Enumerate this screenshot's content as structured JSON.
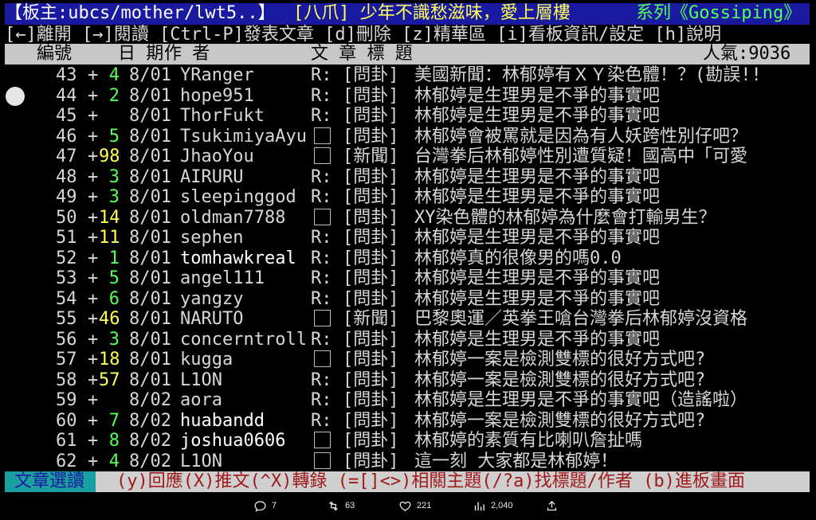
{
  "titlebar": {
    "board": "【板主:ubcs/mother/lwt5..】",
    "category": "[八爪] 少年不識愁滋味，愛上層樓",
    "series": "系列《Gossiping》"
  },
  "keys_line": "[←]離開 [→]閱讀 [Ctrl-P]發表文章 [d]刪除 [z]精華區 [i]看板資訊/設定 [h]說明",
  "header": {
    "num": "編號",
    "date": "日 期",
    "author": "作  者",
    "title": "文  章  標  題",
    "popularity": "人氣:9036"
  },
  "rows": [
    {
      "num": "43",
      "score": "4",
      "date": "8/01",
      "author": "YRanger",
      "mark": "R:",
      "tag": "[問卦]",
      "title": "美國新聞：林郁婷有ＸＹ染色體！？(勘誤!!"
    },
    {
      "num": "44",
      "score": "2",
      "date": "8/01",
      "author": "hope951",
      "mark": "R:",
      "tag": "[問卦]",
      "title": "林郁婷是生理男是不爭的事實吧"
    },
    {
      "num": "45",
      "score": "",
      "date": "8/01",
      "author": "ThorFukt",
      "mark": "R:",
      "tag": "[問卦]",
      "title": "林郁婷是生理男是不爭的事實吧"
    },
    {
      "num": "46",
      "score": "5",
      "date": "8/01",
      "author": "TsukimiyaAyu",
      "mark": "box",
      "tag": "[問卦]",
      "title": "林郁婷會被罵就是因為有人妖跨性別仔吧？"
    },
    {
      "num": "47",
      "score": "98",
      "date": "8/01",
      "author": "JhaoYou",
      "mark": "box",
      "tag": "[新聞]",
      "title": "台灣拳后林郁婷性別遭質疑！國高中「可愛"
    },
    {
      "num": "48",
      "score": "3",
      "date": "8/01",
      "author": "AIRURU",
      "mark": "R:",
      "tag": "[問卦]",
      "title": "林郁婷是生理男是不爭的事實吧"
    },
    {
      "num": "49",
      "score": "3",
      "date": "8/01",
      "author": "sleepinggod",
      "mark": "R:",
      "tag": "[問卦]",
      "title": "林郁婷是生理男是不爭的事實吧"
    },
    {
      "num": "50",
      "score": "14",
      "date": "8/01",
      "author": "oldman7788",
      "mark": "box",
      "tag": "[問卦]",
      "title": "XY染色體的林郁婷為什麼會打輸男生？"
    },
    {
      "num": "51",
      "score": "11",
      "date": "8/01",
      "author": "sephen",
      "mark": "R:",
      "tag": "[問卦]",
      "title": "林郁婷是生理男是不爭的事實吧"
    },
    {
      "num": "52",
      "score": "1",
      "date": "8/01",
      "author": "tomhawkreal",
      "mark": "R:",
      "tag": "[問卦]",
      "title": "林郁婷真的很像男的嗎0.0"
    },
    {
      "num": "53",
      "score": "5",
      "date": "8/01",
      "author": "angel111",
      "mark": "R:",
      "tag": "[問卦]",
      "title": "林郁婷是生理男是不爭的事實吧"
    },
    {
      "num": "54",
      "score": "6",
      "date": "8/01",
      "author": "yangzy",
      "mark": "R:",
      "tag": "[問卦]",
      "title": "林郁婷是生理男是不爭的事實吧"
    },
    {
      "num": "55",
      "score": "46",
      "date": "8/01",
      "author": "NARUTO",
      "mark": "box",
      "tag": "[新聞]",
      "title": "巴黎奧運／英拳王嗆台灣拳后林郁婷沒資格"
    },
    {
      "num": "56",
      "score": "3",
      "date": "8/01",
      "author": "concerntroll",
      "mark": "R:",
      "tag": "[問卦]",
      "title": "林郁婷是生理男是不爭的事實吧"
    },
    {
      "num": "57",
      "score": "18",
      "date": "8/01",
      "author": "kugga",
      "mark": "box",
      "tag": "[問卦]",
      "title": "林郁婷一案是檢測雙標的很好方式吧?"
    },
    {
      "num": "58",
      "score": "57",
      "date": "8/01",
      "author": "L1ON",
      "mark": "R:",
      "tag": "[問卦]",
      "title": "林郁婷一案是檢測雙標的很好方式吧?"
    },
    {
      "num": "59",
      "score": "",
      "date": "8/02",
      "author": "aora",
      "mark": "R:",
      "tag": "[問卦]",
      "title": "林郁婷是生理男是不爭的事實吧（造謠啦）"
    },
    {
      "num": "60",
      "score": "7",
      "date": "8/02",
      "author": "huabandd",
      "mark": "R:",
      "tag": "[問卦]",
      "title": "林郁婷一案是檢測雙標的很好方式吧?"
    },
    {
      "num": "61",
      "score": "8",
      "date": "8/02",
      "author": "joshua0606",
      "mark": "box",
      "tag": "[問卦]",
      "title": "林郁婷的素質有比喇叭詹扯嗎"
    },
    {
      "num": "62",
      "score": "4",
      "date": "8/02",
      "author": "L1ON",
      "mark": "box",
      "tag": "[問卦]",
      "title": "這一刻 大家都是林郁婷！"
    }
  ],
  "footer": {
    "mode": "文章選讀",
    "hints": "(y)回應(X)推文(^X)轉錄 (=[]<>)相關主題(/?a)找標題/作者 (b)進板畫面"
  },
  "social": {
    "replies": "7",
    "reposts": "63",
    "likes": "221",
    "views": "2,040"
  }
}
